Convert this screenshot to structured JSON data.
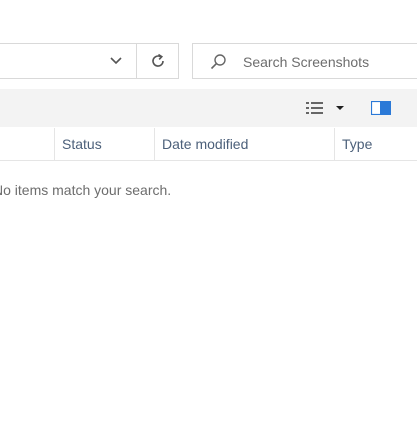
{
  "search": {
    "placeholder": "Search Screenshots"
  },
  "columns": [
    "Status",
    "Date modified",
    "Type"
  ],
  "empty_message": "No items match your search.",
  "icons": {
    "dropdown": "chevron-down-icon",
    "refresh": "refresh-icon",
    "search": "search-icon",
    "view": "details-view-icon",
    "pane": "details-pane-icon"
  },
  "colors": {
    "accent": "#2b79d7",
    "header_text": "#4c607a",
    "muted_text": "#6d6d6d"
  }
}
